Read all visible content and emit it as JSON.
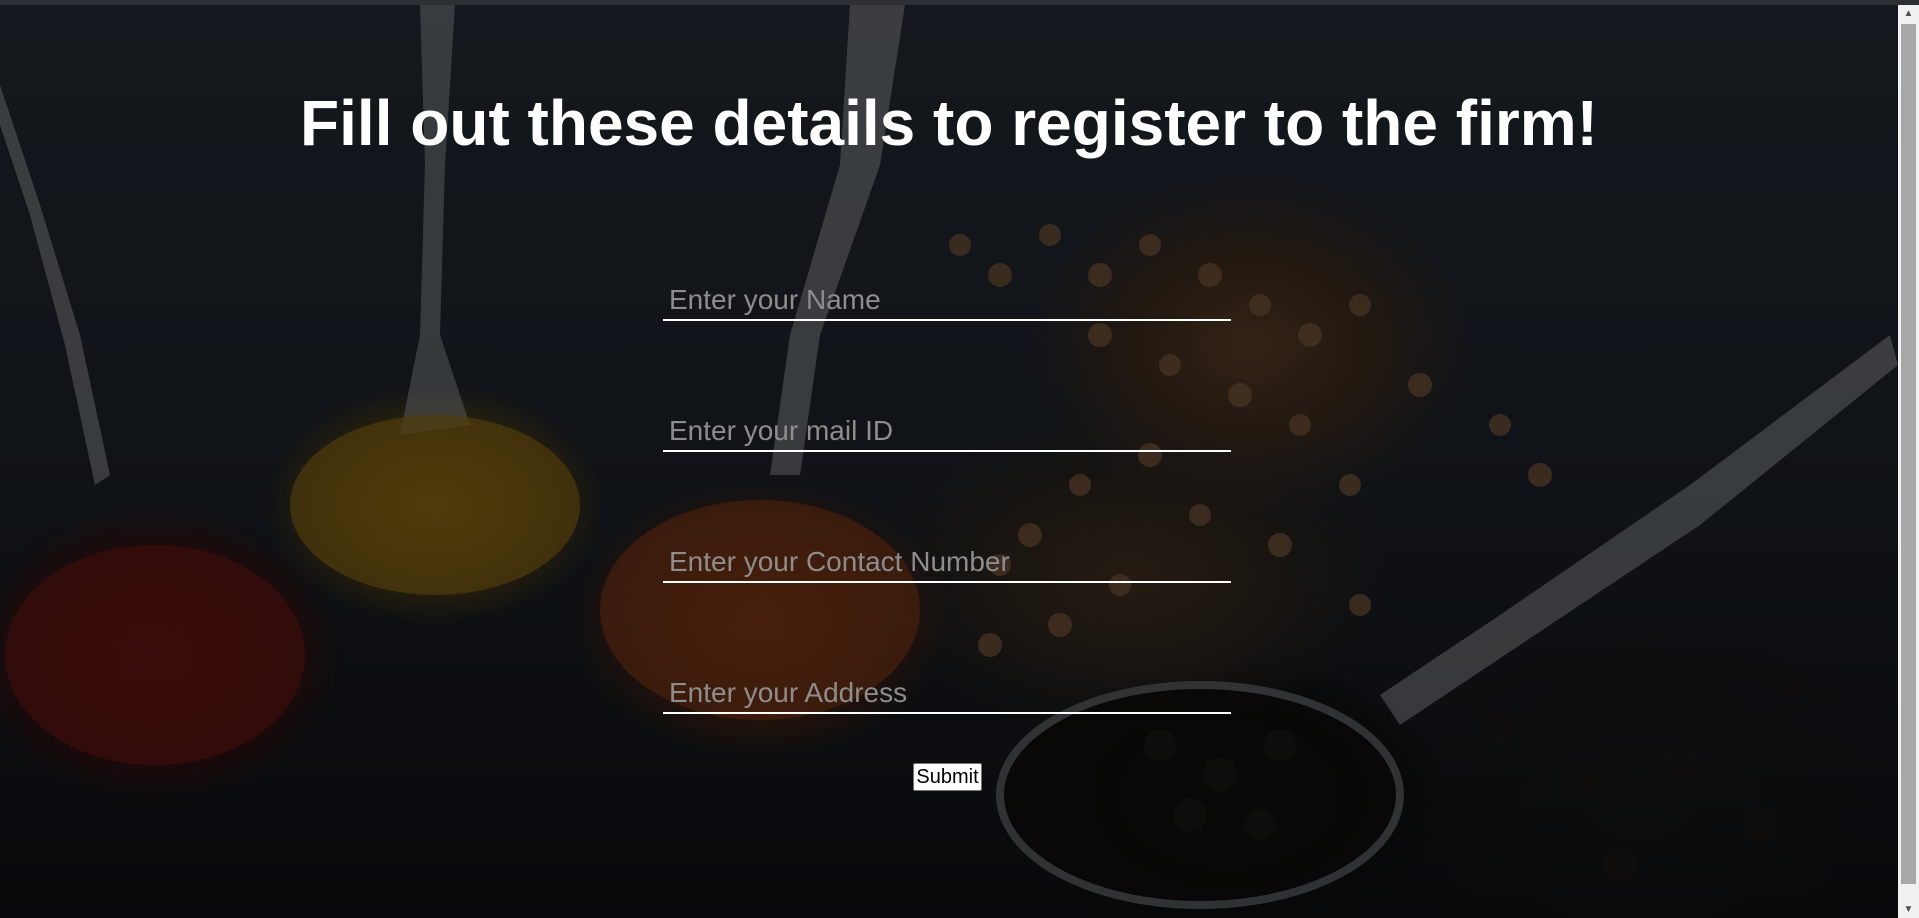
{
  "page": {
    "heading": "Fill out these details to register to the firm!"
  },
  "form": {
    "name_placeholder": "Enter your Name",
    "mail_placeholder": "Enter your mail ID",
    "contact_placeholder": "Enter your Contact Number",
    "address_placeholder": "Enter your Address",
    "submit_label": "Submit"
  },
  "scrollbar": {
    "up_icon": "▲",
    "down_icon": "▼"
  },
  "colors": {
    "heading": "#ffffff",
    "field_underline": "#ffffff",
    "placeholder": "#8d8d8d",
    "background": "#1e2328"
  }
}
